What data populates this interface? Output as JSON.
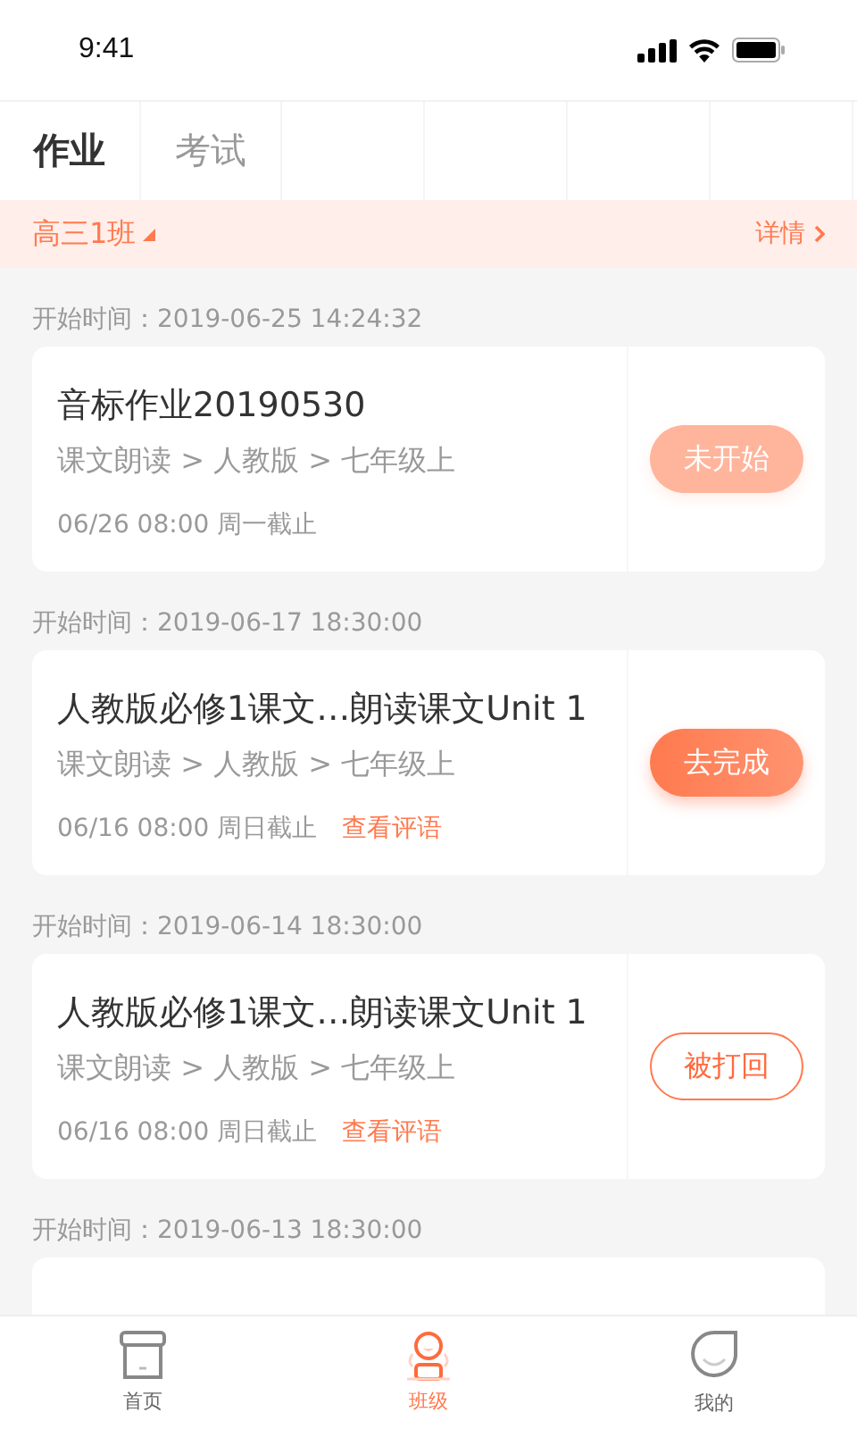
{
  "status_bar": {
    "time": "9:41"
  },
  "tabs": [
    {
      "label": "作业",
      "selected": true
    },
    {
      "label": "考试",
      "selected": false
    }
  ],
  "class_bar": {
    "class_name": "高三1班",
    "details": "详情"
  },
  "assignments": [
    {
      "start_time": "开始时间：2019-06-25 14:24:32",
      "title": "音标作业20190530",
      "path": "课文朗读 > 人教版 > 七年级上",
      "deadline": "06/26 08:00 周一截止",
      "button": {
        "label": "未开始",
        "kind": "not_started"
      }
    },
    {
      "start_time": "开始时间：2019-06-17 18:30:00",
      "title": "人教版必修1课文…朗读课文Unit 1",
      "path": "课文朗读 > 人教版 > 七年级上",
      "deadline": "06/16 08:00 周日截止",
      "comment_link": "查看评语",
      "button": {
        "label": "去完成",
        "kind": "todo"
      }
    },
    {
      "start_time": "开始时间：2019-06-14 18:30:00",
      "title": "人教版必修1课文…朗读课文Unit 1",
      "path": "课文朗读 > 人教版 > 七年级上",
      "deadline": "06/16 08:00 周日截止",
      "comment_link": "查看评语",
      "button": {
        "label": "被打回",
        "kind": "returned"
      }
    },
    {
      "start_time": "开始时间：2019-06-13 18:30:00"
    }
  ],
  "bottom_nav": [
    {
      "label": "首页",
      "kind": "home",
      "selected": false
    },
    {
      "label": "班级",
      "kind": "class",
      "selected": true
    },
    {
      "label": "我的",
      "kind": "me",
      "selected": false
    }
  ]
}
